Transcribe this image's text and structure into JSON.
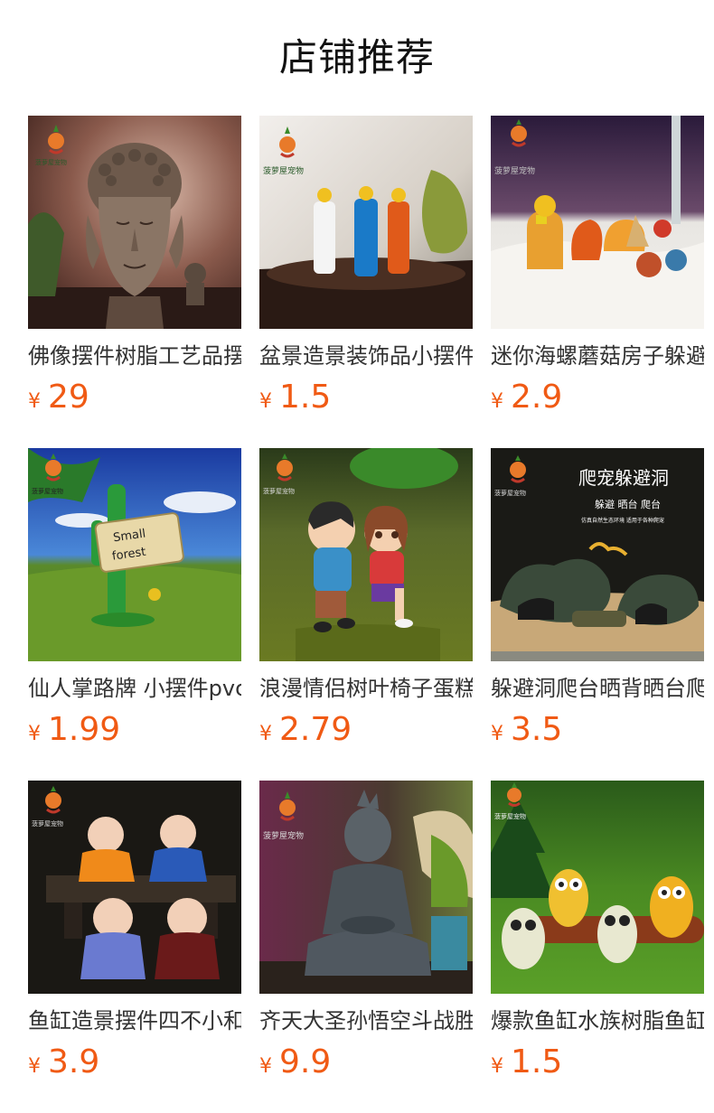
{
  "header": {
    "title": "店铺推荐"
  },
  "products": [
    {
      "title": "佛像摆件树脂工艺品摆件",
      "currency": "¥",
      "price": "29",
      "image": "buddha-head",
      "logo_text": "菠萝屋宠物"
    },
    {
      "title": "盆景造景装饰品小摆件",
      "currency": "¥",
      "price": "1.5",
      "image": "three-figures",
      "logo_text": "菠萝屋宠物"
    },
    {
      "title": "迷你海螺蘑菇房子躲避屋",
      "currency": "¥",
      "price": "2.9",
      "image": "shell-houses",
      "logo_text": "菠萝屋宠物"
    },
    {
      "title": "仙人掌路牌 小摆件pvc",
      "currency": "¥",
      "price": "1.99",
      "image": "cactus-sign",
      "logo_text": "菠萝屋宠物",
      "sign_text": [
        "Small",
        "forest"
      ]
    },
    {
      "title": "浪漫情侣树叶椅子蛋糕摆件",
      "currency": "¥",
      "price": "2.79",
      "image": "couple",
      "logo_text": "菠萝屋宠物"
    },
    {
      "title": "躲避洞爬台晒背晒台爬宠",
      "currency": "¥",
      "price": "3.5",
      "image": "reptile-hide",
      "logo_text": "菠萝屋宠物",
      "banner": {
        "title": "爬宠躲避洞",
        "sub": "躲避  晒台  爬台",
        "small": "仿真自然生态环境 适用于各种爬宠"
      }
    },
    {
      "title": "鱼缸造景摆件四不小和尚",
      "currency": "¥",
      "price": "3.9",
      "image": "monks",
      "logo_text": "菠萝屋宠物"
    },
    {
      "title": "齐天大圣孙悟空斗战胜佛",
      "currency": "¥",
      "price": "9.9",
      "image": "monkey-king",
      "logo_text": "菠萝屋宠物"
    },
    {
      "title": "爆款鱼缸水族树脂鱼缸摆件",
      "currency": "¥",
      "price": "1.5",
      "image": "owls",
      "logo_text": "菠萝屋宠物"
    }
  ]
}
